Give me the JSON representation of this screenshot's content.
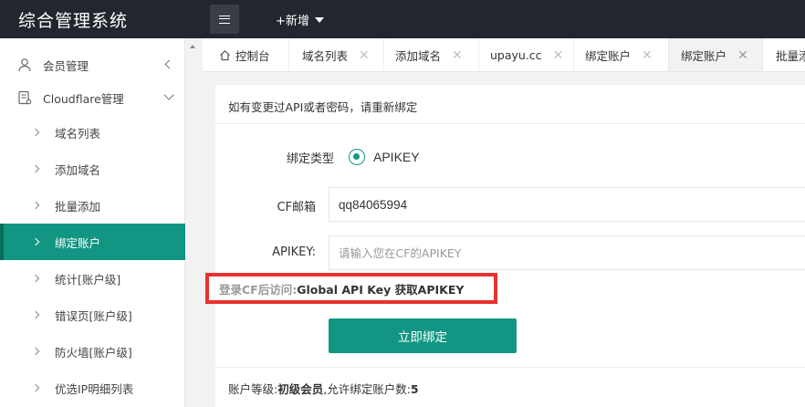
{
  "header": {
    "app_title": "综合管理系统",
    "new_label": "+新增"
  },
  "sidebar": {
    "items": [
      {
        "label": "会员管理"
      },
      {
        "label": "Cloudflare管理"
      },
      {
        "label": "域名列表"
      },
      {
        "label": "添加域名"
      },
      {
        "label": "批量添加"
      },
      {
        "label": "绑定账户"
      },
      {
        "label": "统计[账户级]"
      },
      {
        "label": "错误页[账户级]"
      },
      {
        "label": "防火墙[账户级]"
      },
      {
        "label": "优选IP明细列表"
      }
    ]
  },
  "tabs": [
    {
      "label": "控制台"
    },
    {
      "label": "域名列表"
    },
    {
      "label": "添加域名"
    },
    {
      "label": "upayu.cc"
    },
    {
      "label": "绑定账户"
    },
    {
      "label": "绑定账户"
    },
    {
      "label": "批量添"
    }
  ],
  "form": {
    "notice": "如有变更过API或者密码，请重新绑定",
    "bind_type_label": "绑定类型",
    "bind_type_option": "APIKEY",
    "email_label": "CF邮箱",
    "email_value": "qq84065994",
    "apikey_label": "APIKEY:",
    "apikey_placeholder": "请输入您在CF的APIKEY",
    "hint_prefix": "登录CF后访问:",
    "hint_link": "Global API Key 获取APIKEY",
    "submit_label": "立即绑定"
  },
  "account": {
    "level_label": "账户等级:",
    "level_value": "初级会员",
    "limit_label": ",允许绑定账户数:",
    "limit_value": "5"
  },
  "colors": {
    "accent": "#129683",
    "topbar": "#23262e",
    "highlight_border": "#e8312f"
  }
}
